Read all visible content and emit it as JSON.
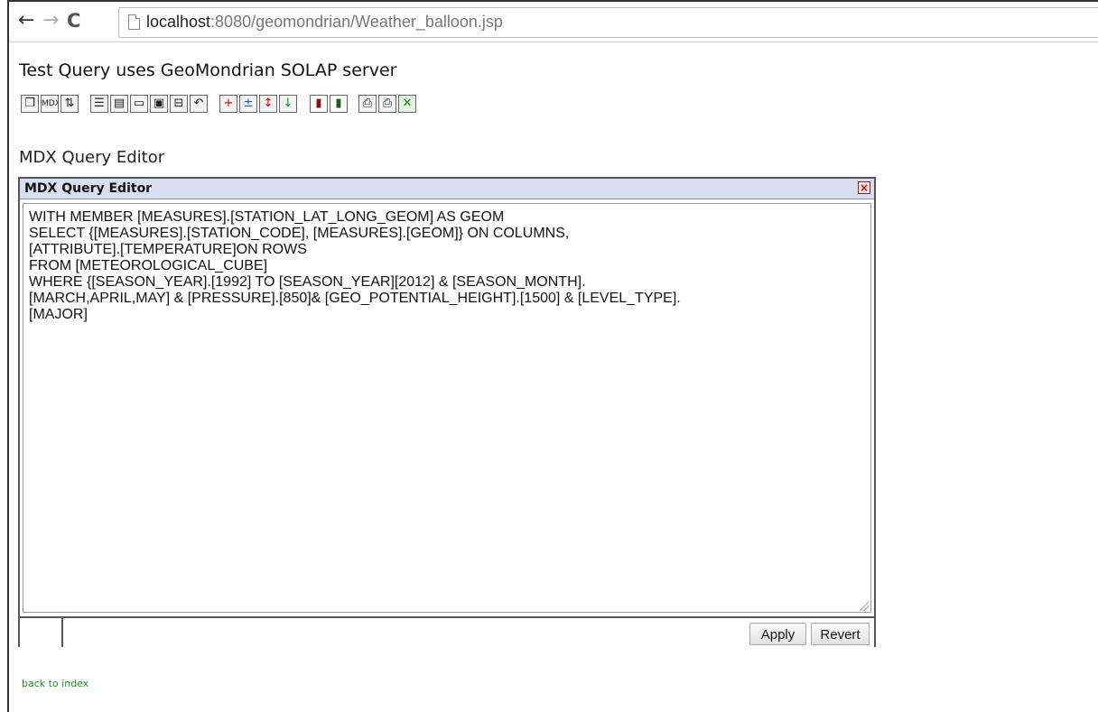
{
  "browser": {
    "url_host": "localhost",
    "url_path": ":8080/geomondrian/Weather_balloon.jsp"
  },
  "page": {
    "title": "Test Query uses GeoMondrian SOLAP server",
    "section_label": "MDX Query Editor",
    "back_link": "back to index"
  },
  "toolbar": {
    "buttons": [
      {
        "name": "cube-navigator-icon",
        "glyph": "❐"
      },
      {
        "name": "mdx-editor-icon",
        "glyph": "MDX"
      },
      {
        "name": "sort-az-icon",
        "glyph": "⇅"
      },
      {
        "name": "show-parents-icon",
        "glyph": "☰"
      },
      {
        "name": "hide-spans-icon",
        "glyph": "▤"
      },
      {
        "name": "properties-icon",
        "glyph": "▭"
      },
      {
        "name": "non-empty-icon",
        "glyph": "▣"
      },
      {
        "name": "suppress-empty-icon",
        "glyph": "⊟"
      },
      {
        "name": "swap-axes-icon",
        "glyph": "↶"
      },
      {
        "name": "drill-member-icon",
        "glyph": "+"
      },
      {
        "name": "drill-position-icon",
        "glyph": "±"
      },
      {
        "name": "drill-replace-icon",
        "glyph": "↕"
      },
      {
        "name": "drill-through-icon",
        "glyph": "↓"
      },
      {
        "name": "show-chart-icon",
        "glyph": "▮"
      },
      {
        "name": "chart-config-icon",
        "glyph": "▮"
      },
      {
        "name": "print-config-icon",
        "glyph": "⎙"
      },
      {
        "name": "print-pdf-icon",
        "glyph": "⎙"
      },
      {
        "name": "export-excel-icon",
        "glyph": "✕"
      }
    ]
  },
  "editor": {
    "title": "MDX Query Editor",
    "close_glyph": "×",
    "query": "WITH MEMBER [MEASURES].[STATION_LAT_LONG_GEOM] AS GEOM\nSELECT {[MEASURES].[STATION_CODE], [MEASURES].[GEOM]} ON COLUMNS,\n[ATTRIBUTE].[TEMPERATURE]ON ROWS\nFROM [METEOROLOGICAL_CUBE]\nWHERE {[SEASON_YEAR].[1992] TO [SEASON_YEAR][2012] & [SEASON_MONTH].\n[MARCH,APRIL,MAY] & [PRESSURE].[850]& [GEO_POTENTIAL_HEIGHT].[1500] & [LEVEL_TYPE].\n[MAJOR]",
    "apply_label": "Apply",
    "revert_label": "Revert"
  },
  "colors": {
    "editor_header_bg": "#d9def0",
    "link_color": "#2a8a2a",
    "close_icon_color": "#c00000"
  }
}
